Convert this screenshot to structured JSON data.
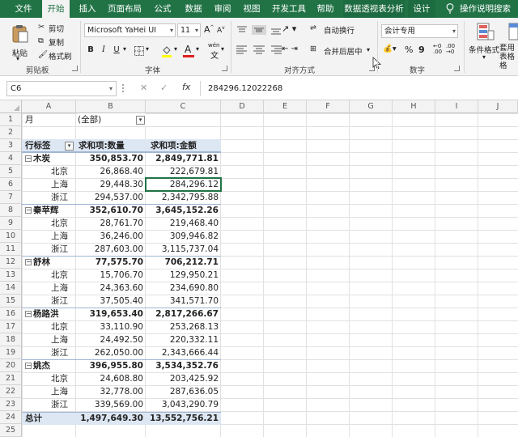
{
  "ribbon_tabs": [
    "文件",
    "开始",
    "插入",
    "页面布局",
    "公式",
    "数据",
    "审阅",
    "视图",
    "开发工具",
    "帮助",
    "数据透视表分析",
    "设计"
  ],
  "active_tab": "开始",
  "tell_me": "操作说明搜索",
  "clipboard": {
    "paste": "粘贴",
    "cut": "剪切",
    "copy": "复制",
    "format_painter": "格式刷",
    "label": "剪贴板"
  },
  "font": {
    "name": "Microsoft YaHei UI",
    "size": "11",
    "grow": "A",
    "shrink": "A",
    "bold": "B",
    "italic": "I",
    "underline": "U",
    "wen": "wén",
    "label": "字体"
  },
  "alignment": {
    "wrap_text": "自动换行",
    "merge_center": "合并后居中",
    "label": "对齐方式"
  },
  "number": {
    "format": "会计专用",
    "percent": "%",
    "comma": "9",
    "label": "数字"
  },
  "styles": {
    "conditional_format": "条件格式",
    "table_format": "套用 表格格"
  },
  "name_box": "C6",
  "formula_value": "284296.12022268",
  "fx_label": "fx",
  "columns": [
    "A",
    "B",
    "C",
    "D",
    "E",
    "F",
    "G",
    "H",
    "I",
    "J"
  ],
  "row_numbers": [
    "1",
    "2",
    "3",
    "4",
    "5",
    "6",
    "7",
    "8",
    "9",
    "10",
    "11",
    "12",
    "13",
    "14",
    "15",
    "16",
    "17",
    "18",
    "19",
    "20",
    "21",
    "22",
    "23",
    "24",
    "25"
  ],
  "pivot": {
    "filter_label": "月",
    "filter_value": "(全部)",
    "row_label_header": "行标签",
    "col1_header": "求和项:数量",
    "col2_header": "求和项:金额",
    "groups": [
      {
        "name": "木炭",
        "qty": "350,853.70",
        "amt": "2,849,771.81",
        "items": [
          {
            "region": "北京",
            "qty": "26,868.40",
            "amt": "222,679.81"
          },
          {
            "region": "上海",
            "qty": "29,448.30",
            "amt": "284,296.12"
          },
          {
            "region": "浙江",
            "qty": "294,537.00",
            "amt": "2,342,795.88"
          }
        ]
      },
      {
        "name": "秦苹辉",
        "qty": "352,610.70",
        "amt": "3,645,152.26",
        "items": [
          {
            "region": "北京",
            "qty": "28,761.70",
            "amt": "219,468.40"
          },
          {
            "region": "上海",
            "qty": "36,246.00",
            "amt": "309,946.82"
          },
          {
            "region": "浙江",
            "qty": "287,603.00",
            "amt": "3,115,737.04"
          }
        ]
      },
      {
        "name": "舒林",
        "qty": "77,575.70",
        "amt": "706,212.71",
        "items": [
          {
            "region": "北京",
            "qty": "15,706.70",
            "amt": "129,950.21"
          },
          {
            "region": "上海",
            "qty": "24,363.60",
            "amt": "234,690.80"
          },
          {
            "region": "浙江",
            "qty": "37,505.40",
            "amt": "341,571.70"
          }
        ]
      },
      {
        "name": "杨路洪",
        "qty": "319,653.40",
        "amt": "2,817,266.67",
        "items": [
          {
            "region": "北京",
            "qty": "33,110.90",
            "amt": "253,268.13"
          },
          {
            "region": "上海",
            "qty": "24,492.50",
            "amt": "220,332.11"
          },
          {
            "region": "浙江",
            "qty": "262,050.00",
            "amt": "2,343,666.44"
          }
        ]
      },
      {
        "name": "姚杰",
        "qty": "396,955.80",
        "amt": "3,534,352.76",
        "items": [
          {
            "region": "北京",
            "qty": "24,608.80",
            "amt": "203,425.92"
          },
          {
            "region": "上海",
            "qty": "32,778.00",
            "amt": "287,636.05"
          },
          {
            "region": "浙江",
            "qty": "339,569.00",
            "amt": "3,043,290.79"
          }
        ]
      }
    ],
    "total_label": "总计",
    "total_qty": "1,497,649.30",
    "total_amt": "13,552,756.21"
  },
  "colors": {
    "excel_green": "#217346",
    "pivot_header": "#dde7f3",
    "pivot_line": "#9fb6d4"
  }
}
